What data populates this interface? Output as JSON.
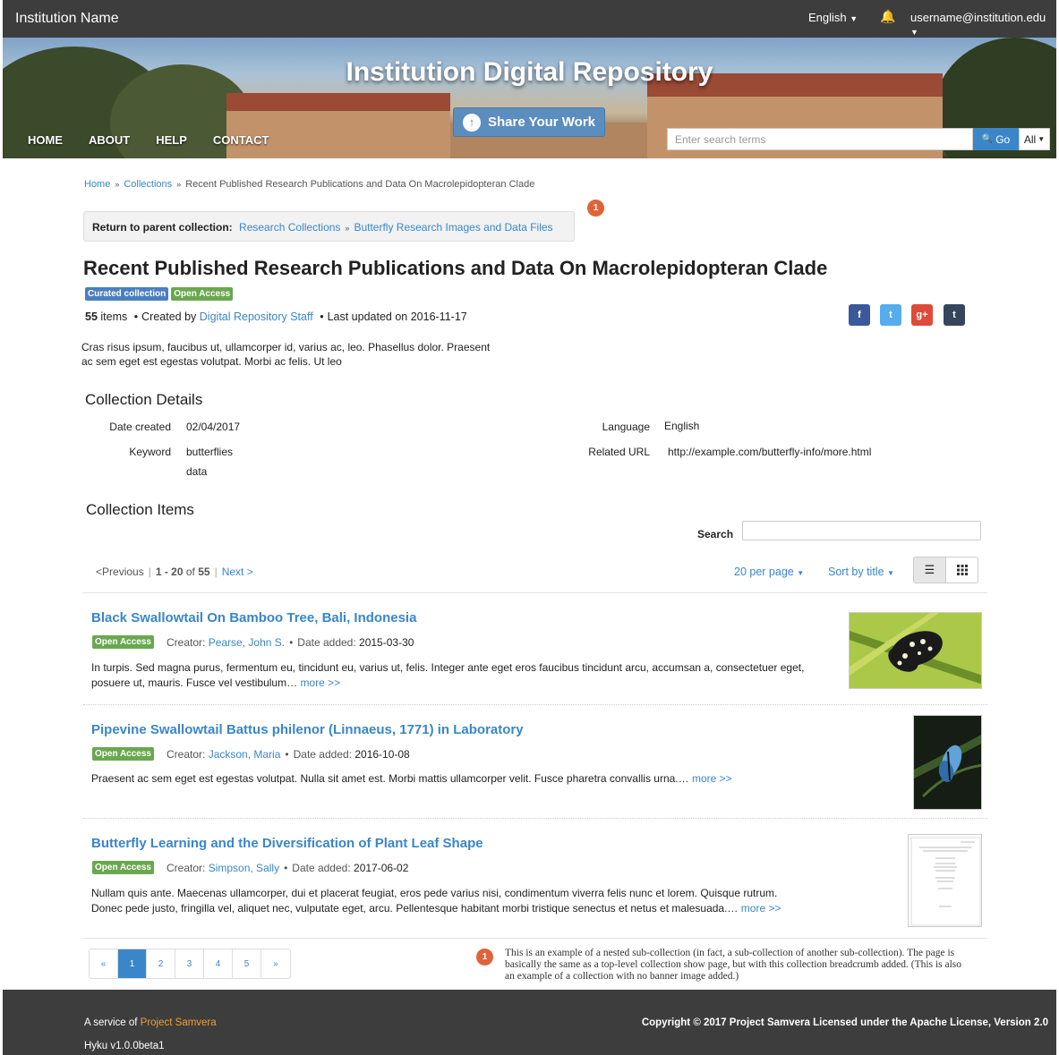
{
  "topbar": {
    "institution_name": "Institution Name",
    "language": "English",
    "user": "username@institution.edu"
  },
  "banner": {
    "title": "Institution Digital Repository",
    "share_label": "Share Your Work",
    "nav": [
      "HOME",
      "ABOUT",
      "HELP",
      "CONTACT"
    ],
    "search_placeholder": "Enter search terms",
    "go_label": "Go",
    "scope_label": "All"
  },
  "breadcrumb": [
    "Home",
    "Collections",
    "Recent Published Research Publications and Data On Macrolepidopteran Clade"
  ],
  "annotation_marker": "1",
  "parent_collection": {
    "label": "Return to parent collection:",
    "links": [
      "Research Collections",
      "Butterfly Research Images and Data Files"
    ]
  },
  "collection": {
    "title": "Recent Published Research Publications and Data On Macrolepidopteran Clade",
    "tags": [
      "Curated collection",
      "Open Access"
    ],
    "item_count": "55",
    "items_word": "items",
    "created_by_label": "Created by",
    "creator": "Digital Repository Staff",
    "last_updated_label": "Last updated on 2016-11-17",
    "description": "Cras risus ipsum, faucibus ut, ullamcorper id, varius ac, leo. Phasellus dolor. Praesent ac sem eget est egestas volutpat. Morbi ac felis. Ut leo"
  },
  "social": [
    "f",
    "t",
    "g+",
    "t"
  ],
  "colors": {
    "facebook": "#3b5998",
    "twitter": "#55acee",
    "google": "#dd4b39",
    "tumblr": "#35465c",
    "link": "#3a86c8",
    "open_access": "#6aa84f",
    "curated": "#4a7fc1"
  },
  "details": {
    "heading": "Collection Details",
    "date_created_label": "Date created",
    "date_created": "02/04/2017",
    "keyword_label": "Keyword",
    "keywords": [
      "butterflies",
      "data"
    ],
    "language_label": "Language",
    "language": "English",
    "related_url_label": "Related URL",
    "related_url": "http://example.com/butterfly-info/more.html"
  },
  "items_section": {
    "heading": "Collection Items",
    "search_label": "Search",
    "previous": "Previous",
    "range": "1 - 20",
    "of_label": "of",
    "total": "55",
    "next": "Next",
    "per_page": "20 per page",
    "sort": "Sort by title"
  },
  "items": [
    {
      "title": "Black Swallowtail On Bamboo Tree, Bali, Indonesia",
      "access": "Open Access",
      "creator_label": "Creator:",
      "creator": "Pearse, John S.",
      "date_label": "Date added:",
      "date": "2015-03-30",
      "description": "In turpis. Sed magna purus, fermentum eu, tincidunt eu, varius ut, felis. Integer ante eget eros faucibus tincidunt arcu, accumsan a, consectetuer eget, posuere ut, mauris. Fusce vel vestibulum…",
      "more": "more >>"
    },
    {
      "title": "Pipevine Swallowtail Battus philenor (Linnaeus, 1771) in Laboratory",
      "access": "Open Access",
      "creator_label": "Creator:",
      "creator": "Jackson, Maria",
      "date_label": "Date added:",
      "date": "2016-10-08",
      "description": "Praesent ac sem eget est egestas volutpat. Nulla sit amet est. Morbi mattis ullamcorper velit. Fusce pharetra convallis urna.…",
      "more": "more >>"
    },
    {
      "title": "Butterfly Learning and the Diversification of Plant Leaf Shape",
      "access": "Open Access",
      "creator_label": "Creator:",
      "creator": "Simpson, Sally",
      "date_label": "Date added:",
      "date": "2017-06-02",
      "description": "Nullam quis ante. Maecenas ullamcorper, dui et placerat feugiat, eros pede varius nisi, condimentum viverra felis nunc et lorem. Quisque rutrum. Donec pede justo, fringilla vel, aliquet nec, vulputate eget, arcu. Pellentesque habitant morbi tristique senectus et netus et malesuada.…",
      "more": "more >>"
    }
  ],
  "pagination": [
    "«",
    "1",
    "2",
    "3",
    "4",
    "5",
    "»"
  ],
  "note": "This is an example of a nested sub-collection (in fact, a sub-collection of another sub-collection). The page is basically the same as a top-level collection show page, but with this collection breadcrumb added. (This is also an example of a collection with no banner image added.)",
  "footer": {
    "service_prefix": "A service of",
    "service_link": "Project Samvera",
    "version": "Hyku v1.0.0beta1",
    "copyright": "Copyright © 2017 Project Samvera Licensed under the Apache License, Version 2.0"
  }
}
